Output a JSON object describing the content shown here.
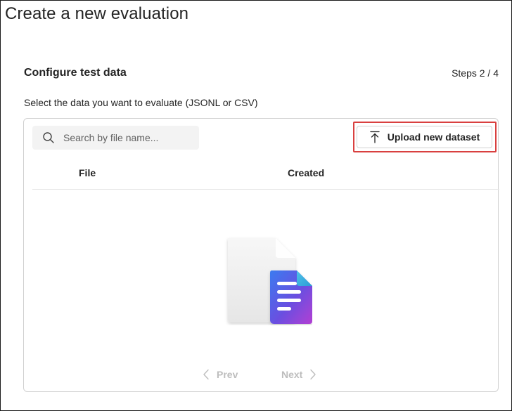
{
  "page": {
    "title": "Create a new evaluation"
  },
  "section": {
    "title": "Configure test data",
    "steps": "Steps 2 / 4",
    "instructions": "Select the data you want to evaluate (JSONL or CSV)"
  },
  "toolbar": {
    "search_placeholder": "Search by file name...",
    "search_value": "",
    "upload_label": "Upload new dataset"
  },
  "table": {
    "columns": [
      "File",
      "Created"
    ],
    "rows": []
  },
  "pagination": {
    "prev_label": "Prev",
    "next_label": "Next"
  },
  "icons": {
    "search": "search-icon",
    "upload": "upload-arrow-icon",
    "empty_state": "document-illustration",
    "prev": "chevron-left-icon",
    "next": "chevron-right-icon"
  },
  "colors": {
    "highlight": "#d9403f",
    "disabled_text": "#bdbdbd",
    "doc_gradient_start": "#3b7bf0",
    "doc_gradient_end": "#b23fd3"
  }
}
